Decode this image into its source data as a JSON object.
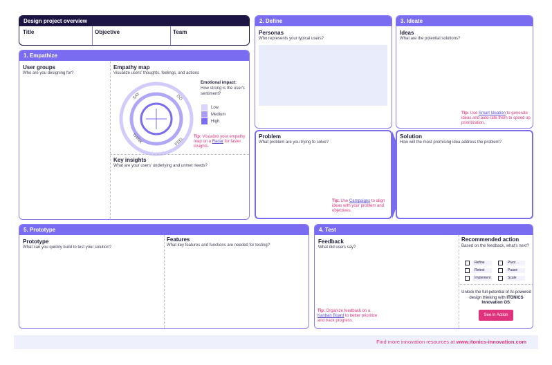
{
  "overview": {
    "title": "Design project overview",
    "cols": [
      "Title",
      "Objective",
      "Team"
    ]
  },
  "empathize": {
    "header": "1. Empathize",
    "user_groups": {
      "title": "User groups",
      "sub": "Who are you designing for?"
    },
    "empathy_map": {
      "title": "Empathy map",
      "sub": "Visualize users' thoughts, feelings, and actions",
      "labels": {
        "say": "SAY",
        "do": "DO",
        "think": "THINK",
        "feel": "FEEL"
      }
    },
    "emotional": {
      "title": "Emotional impact:",
      "sub": "How strong is the user's sentiment?",
      "levels": [
        "Low",
        "Medium",
        "High"
      ],
      "colors": [
        "#d9d4fb",
        "#a99cf5",
        "#7a6cf0"
      ]
    },
    "tip": {
      "prefix": "Tip:",
      "text1": " Visualize your empathy map on a ",
      "link": "Radar",
      "text2": " for faster insights."
    },
    "key_insights": {
      "title": "Key insights",
      "sub": "What are your users' underlying and unmet needs?"
    }
  },
  "define": {
    "header": "2. Define",
    "personas": {
      "title": "Personas",
      "sub": "Who represents your typical users?"
    },
    "problem": {
      "title": "Problem",
      "sub": "What problem are you trying to solve?"
    },
    "tip": {
      "prefix": "Tip:",
      "text1": " Use ",
      "link": "Campaigns",
      "text2": " to align ideas with your problem and objectives."
    }
  },
  "ideate": {
    "header": "3. Ideate",
    "ideas": {
      "title": "Ideas",
      "sub": "What are the potential solutions?"
    },
    "tip": {
      "prefix": "Tip:",
      "text1": " Use ",
      "link": "Smart Ideation",
      "text2": " to generate ideas and auto-rate them to speed up prioritization."
    },
    "solution": {
      "title": "Solution",
      "sub": "How will the most promising idea address the problem?"
    }
  },
  "prototype": {
    "header": "5. Prototype",
    "prototype": {
      "title": "Prototype",
      "sub": "What can you quickly build to test your solution?"
    },
    "features": {
      "title": "Features",
      "sub": "What key features and functions are needed for testing?"
    }
  },
  "test": {
    "header": "4. Test",
    "feedback": {
      "title": "Feedback",
      "sub": "What did users say?"
    },
    "tip": {
      "prefix": "Tip:",
      "text1": " Organize feedback on a ",
      "link": "Kanban Board",
      "text2": " to better prioritize and track progress."
    },
    "recommended": {
      "title": "Recommended action",
      "sub": "Based on the feedback, what's next?",
      "options": [
        "Refine",
        "Pivot",
        "Retest",
        "Pause",
        "Implement",
        "Scale"
      ]
    },
    "unlock": {
      "text": "Unlock the full potential of AI-powered design thinking with",
      "brand": "ITONICS Innovation OS",
      "end": "."
    },
    "cta": "See in Action"
  },
  "footer": {
    "text": "Find more innovation resources at ",
    "link": "www.itonics-innovation.com"
  },
  "colors": {
    "accent": "#7a6cf0",
    "dark": "#1c1442",
    "pink": "#e0337e",
    "persona_box": "#e8ecfb",
    "footer_bg": "#eef1fb"
  }
}
